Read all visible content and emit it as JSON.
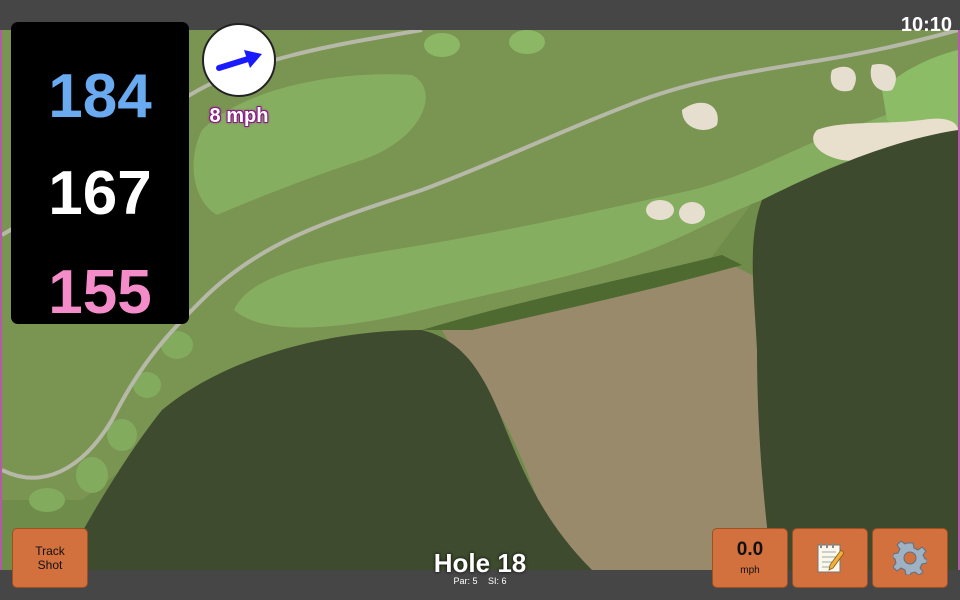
{
  "status_bar": {
    "time": "10:10"
  },
  "distances": {
    "back": "184",
    "middle": "167",
    "front": "155",
    "colors": {
      "back": "#6aaaf0",
      "middle": "#ffffff",
      "front": "#f38cc8"
    }
  },
  "wind": {
    "speed_label": "8 mph",
    "direction_icon": "arrow-east-northeast-icon",
    "arrow_color": "#1a1aff"
  },
  "hole": {
    "title": "Hole 18",
    "par_label": "Par: 5",
    "si_label": "SI: 6"
  },
  "buttons": {
    "track_shot_line1": "Track",
    "track_shot_line2": "Shot",
    "speed_value": "0.0",
    "speed_unit": "mph",
    "notes_icon": "notepad-icon",
    "settings_icon": "gear-icon"
  },
  "theme": {
    "button_color": "#d2703e",
    "bar_color": "#464646",
    "water_color": "#3a4a2c",
    "fairway_color": "#7faa5c"
  }
}
